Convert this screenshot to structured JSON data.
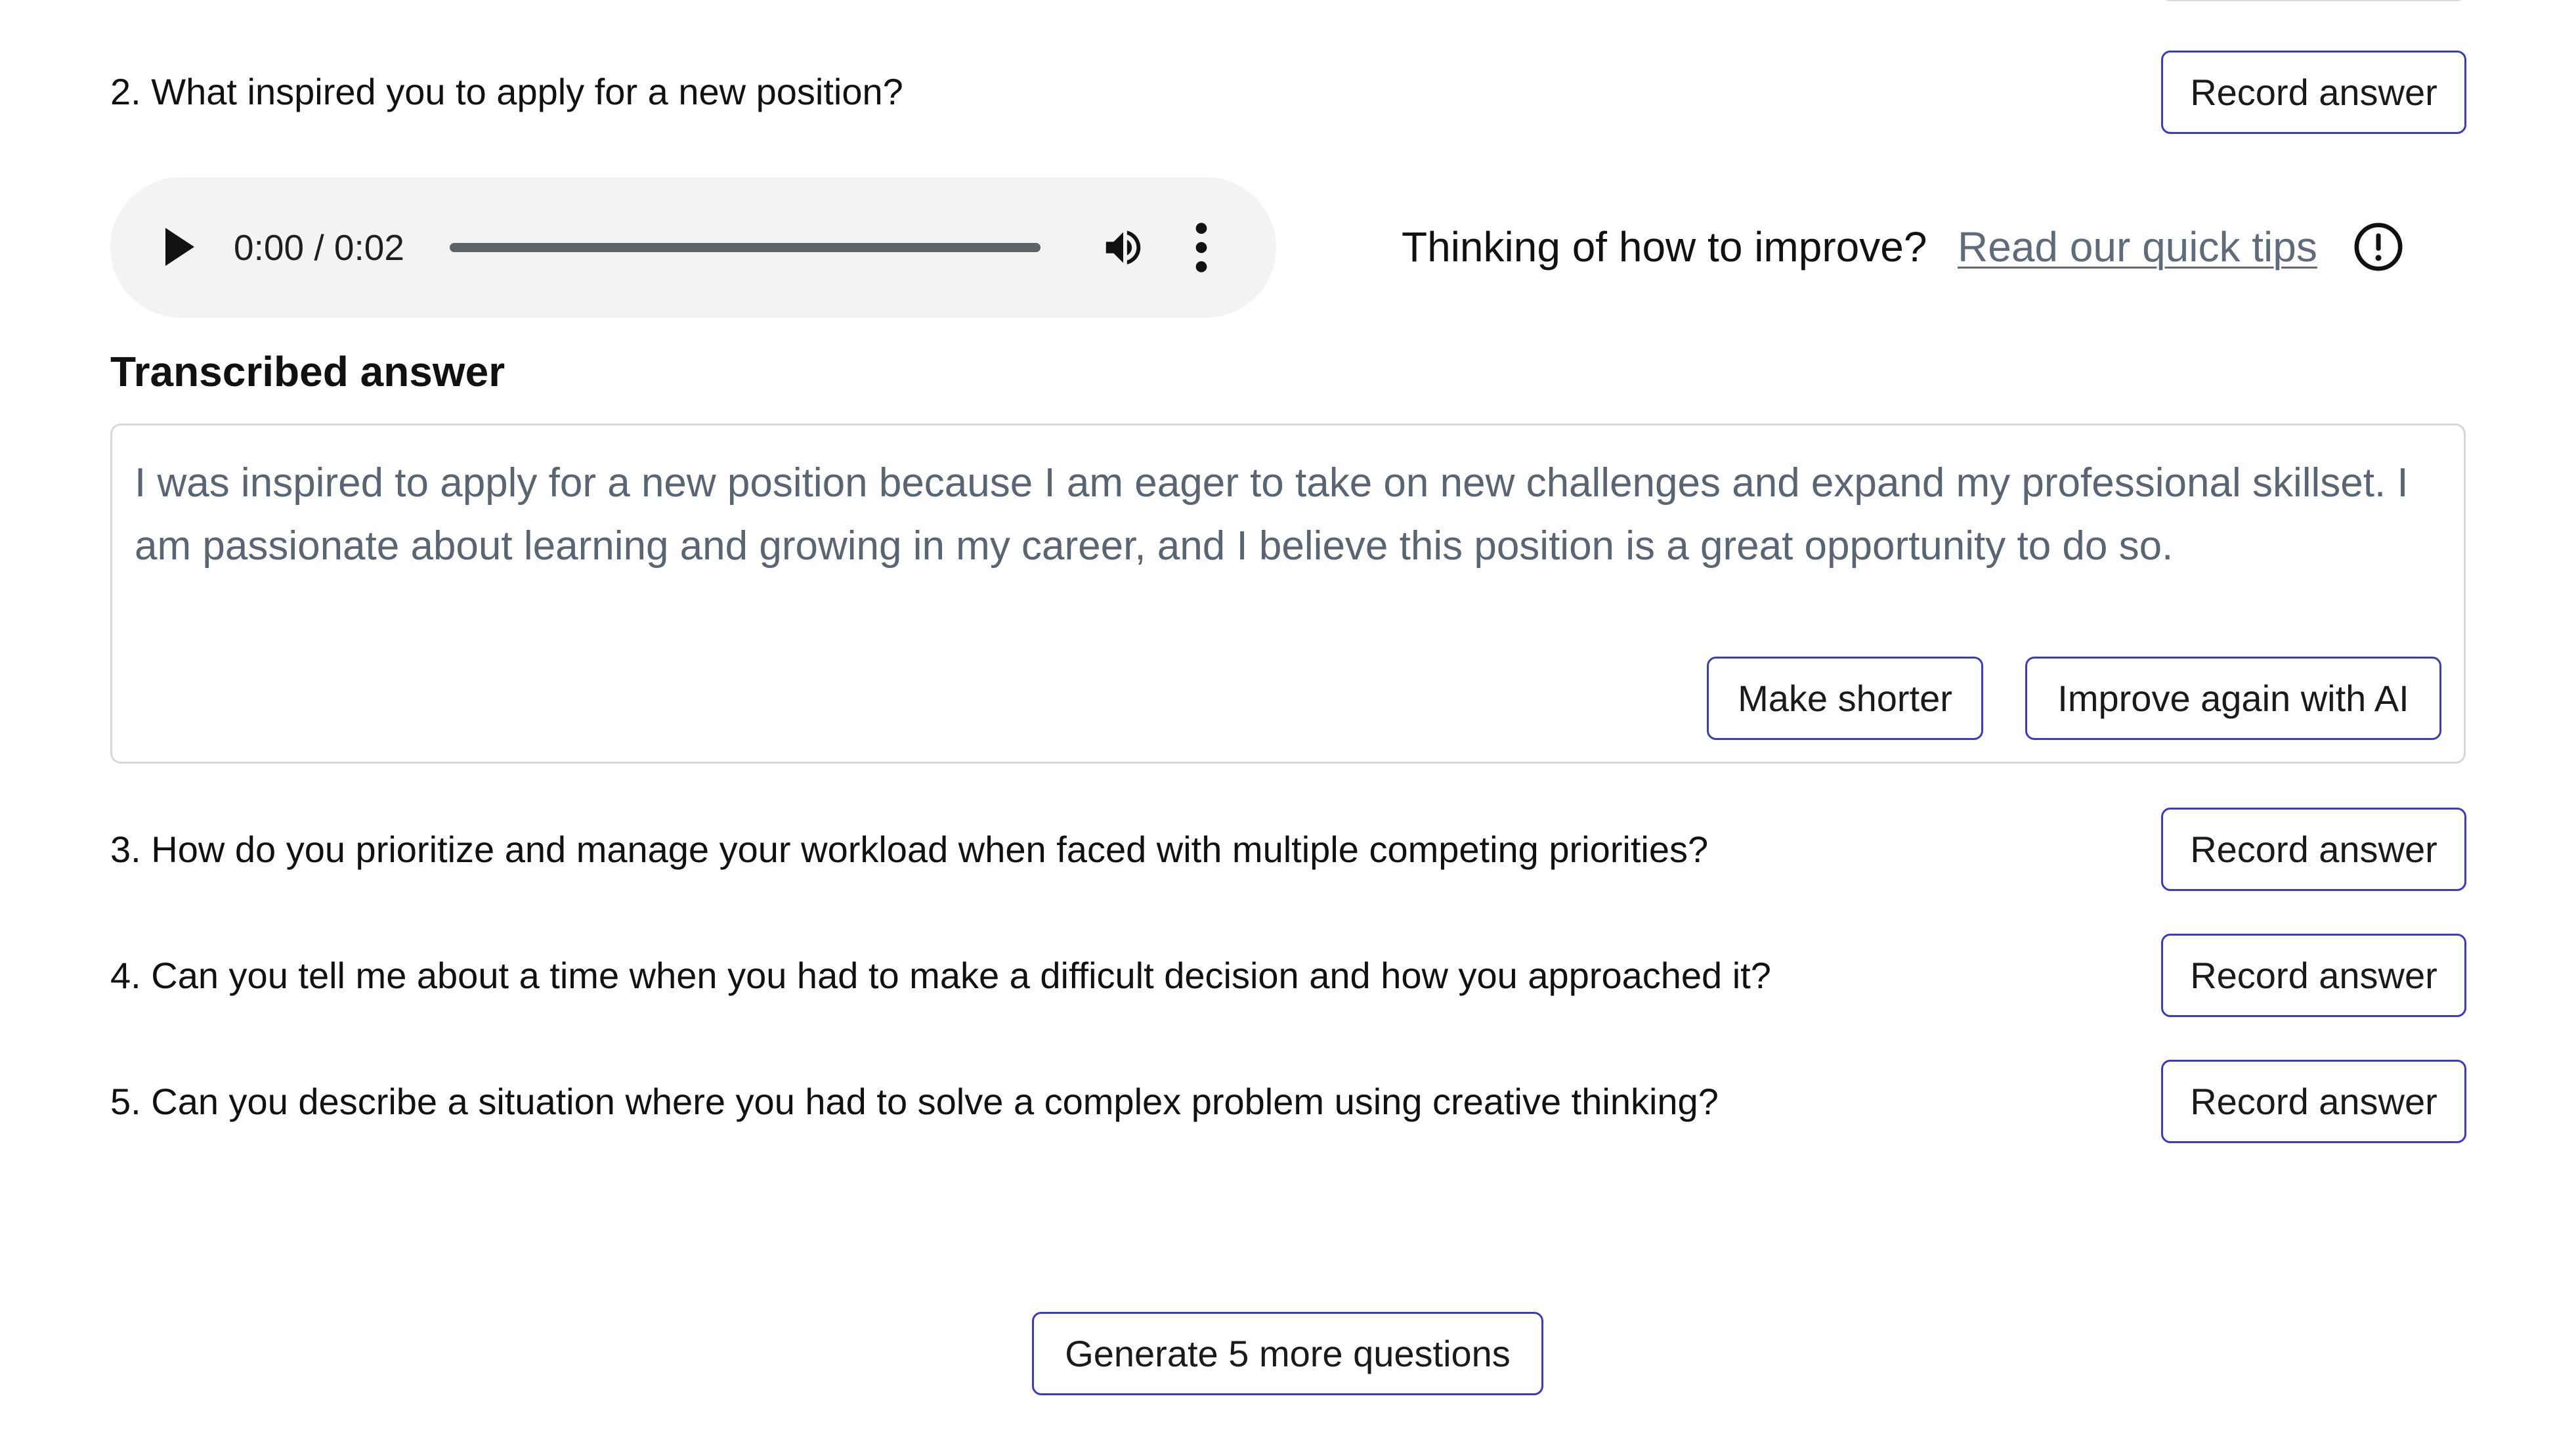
{
  "questions": [
    {
      "text": "2. What inspired you to apply for a new position?",
      "button_label": "Record answer"
    },
    {
      "text": "3. How do you prioritize and manage your workload when faced with multiple competing priorities?",
      "button_label": "Record answer"
    },
    {
      "text": "4. Can you tell me about a time when you had to make a difficult decision and how you approached it?",
      "button_label": "Record answer"
    },
    {
      "text": "5. Can you describe a situation where you had to solve a complex problem using creative thinking?",
      "button_label": "Record answer"
    }
  ],
  "audio_player": {
    "time_display": "0:00 / 0:02"
  },
  "tips": {
    "prompt": "Thinking of how to improve?",
    "link_label": "Read our quick tips"
  },
  "transcription": {
    "title": "Transcribed answer",
    "text": "I was inspired to apply for a new position because I am eager to take on new challenges and expand my professional skillset. I am passionate about learning and growing in my career, and I believe this position is a great opportunity to do so.",
    "make_shorter_label": "Make shorter",
    "improve_label": "Improve again with AI"
  },
  "footer": {
    "generate_label": "Generate 5 more questions"
  },
  "colors": {
    "button_border": "#3b3bbf",
    "link": "#5f6b7a",
    "transcript_text": "#5a6472",
    "audio_bg": "#f1f3f4"
  }
}
